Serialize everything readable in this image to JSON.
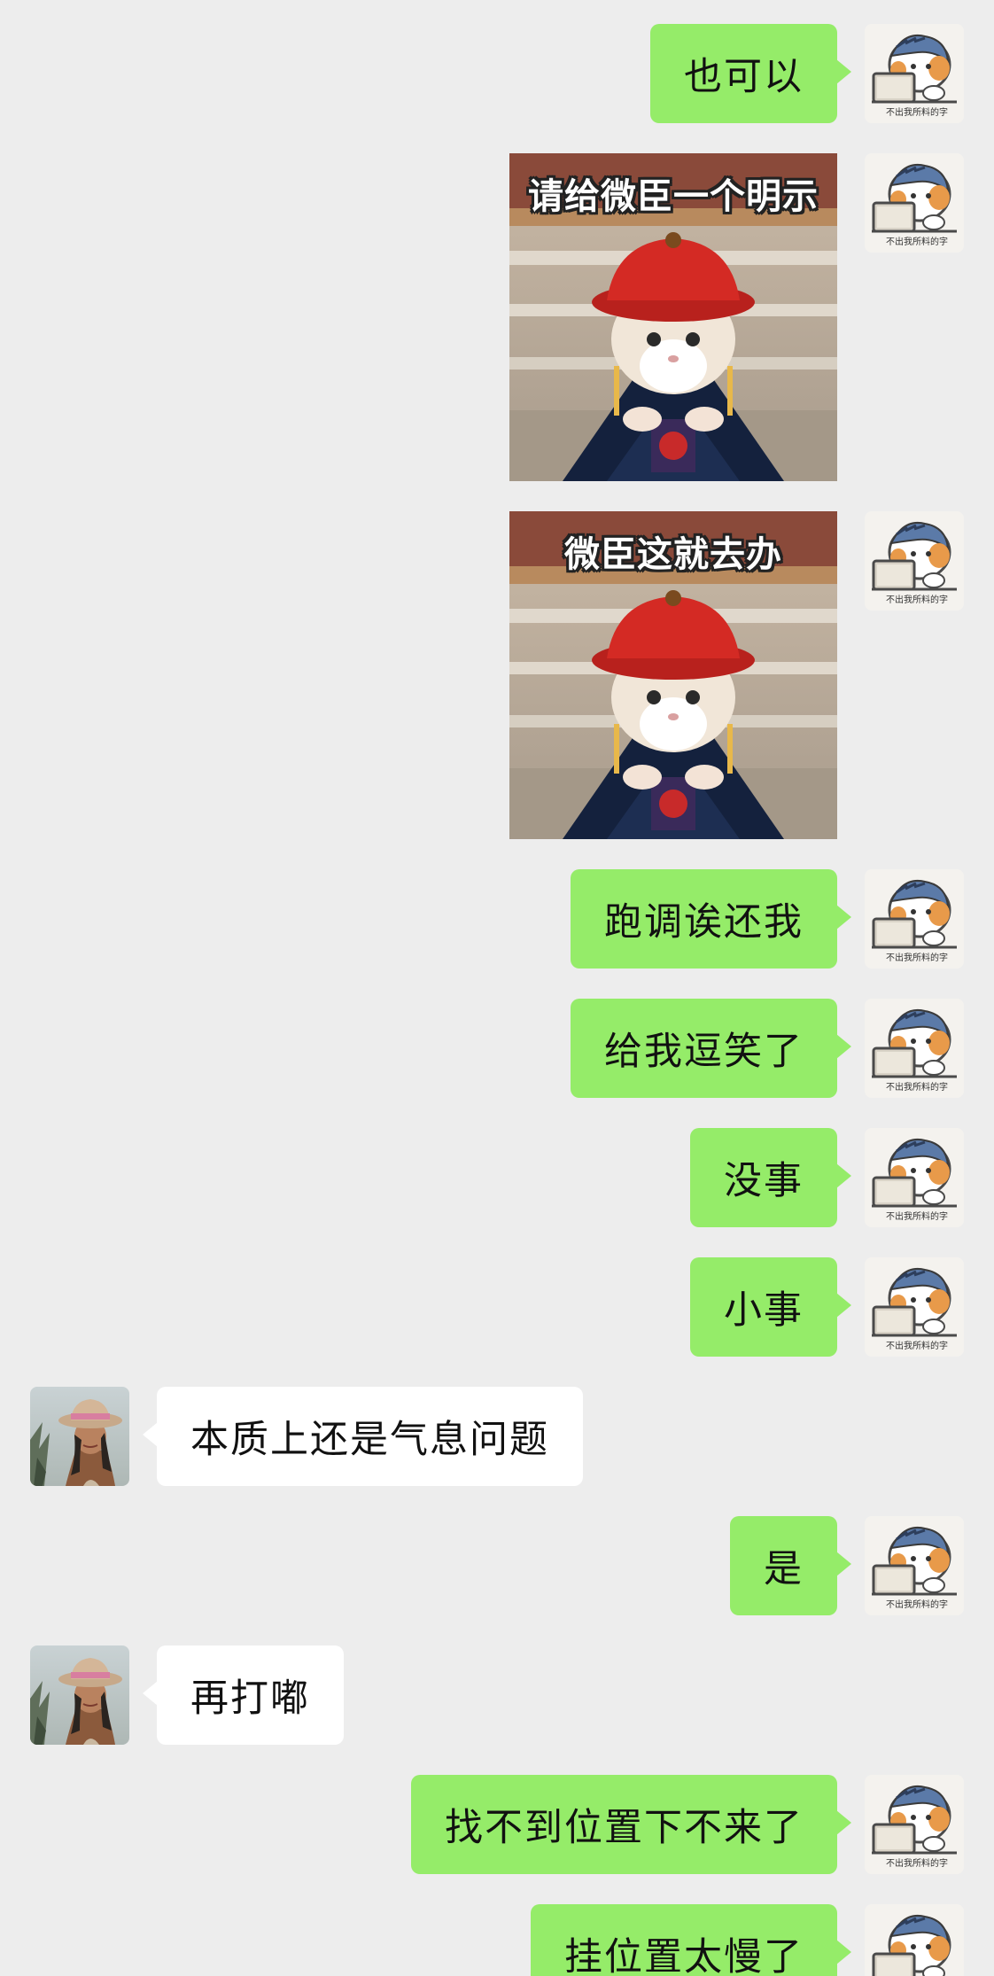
{
  "chat": {
    "messages": [
      {
        "side": "right",
        "type": "text",
        "text": "也可以"
      },
      {
        "side": "right",
        "type": "sticker",
        "caption": "请给微臣一个明示",
        "sticker_icon": "cat-official-sticker"
      },
      {
        "side": "right",
        "type": "sticker",
        "caption": "微臣这就去办",
        "sticker_icon": "cat-official-sticker"
      },
      {
        "side": "right",
        "type": "text",
        "text": "跑调诶还我"
      },
      {
        "side": "right",
        "type": "text",
        "text": "给我逗笑了"
      },
      {
        "side": "right",
        "type": "text",
        "text": "没事"
      },
      {
        "side": "right",
        "type": "text",
        "text": "小事"
      },
      {
        "side": "left",
        "type": "text",
        "text": "本质上还是气息问题"
      },
      {
        "side": "right",
        "type": "text",
        "text": "是"
      },
      {
        "side": "left",
        "type": "text",
        "text": "再打嘟"
      },
      {
        "side": "right",
        "type": "text",
        "text": "找不到位置下不来了"
      },
      {
        "side": "right",
        "type": "text",
        "text": "挂位置太慢了"
      }
    ]
  },
  "avatars": {
    "self": {
      "icon": "cartoon-cat-at-laptop-avatar",
      "caption": "不出我所料的字"
    },
    "other": {
      "icon": "woman-in-hat-photo-avatar"
    }
  },
  "colors": {
    "background": "#ededed",
    "self_bubble": "#95ec69",
    "other_bubble": "#ffffff",
    "text": "#111111"
  }
}
